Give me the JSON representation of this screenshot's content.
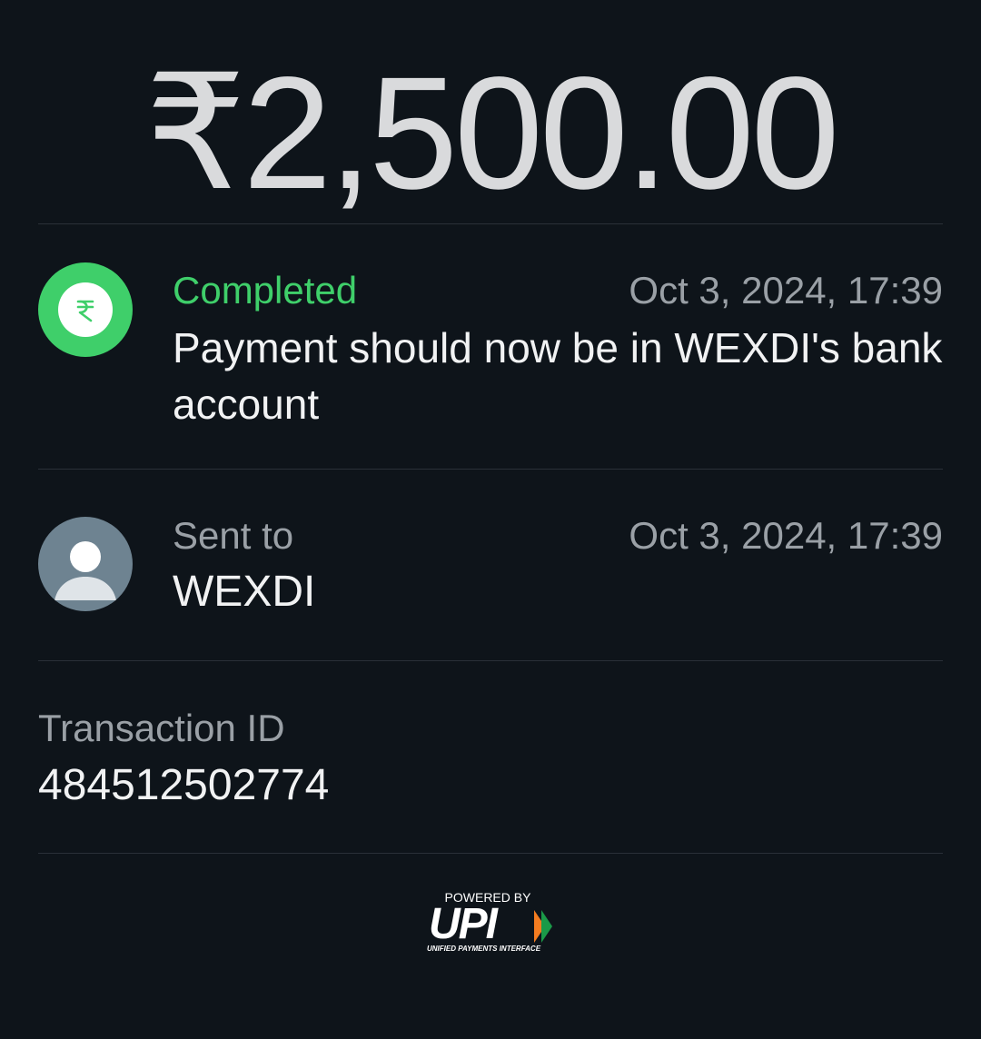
{
  "amount": "₹2,500.00",
  "status": {
    "icon": "rupee-icon",
    "label": "Completed",
    "date": "Oct 3, 2024, 17:39",
    "message": "Payment should now be in WEXDI's bank account",
    "color": "#3fcf6a"
  },
  "recipient": {
    "icon": "person-icon",
    "label": "Sent to",
    "name": "WEXDI",
    "date": "Oct 3, 2024, 17:39"
  },
  "transaction": {
    "label": "Transaction ID",
    "id": "484512502774"
  },
  "footer": {
    "powered_by": "POWERED BY",
    "logo_text": "UPI",
    "tagline": "UNIFIED PAYMENTS INTERFACE"
  }
}
